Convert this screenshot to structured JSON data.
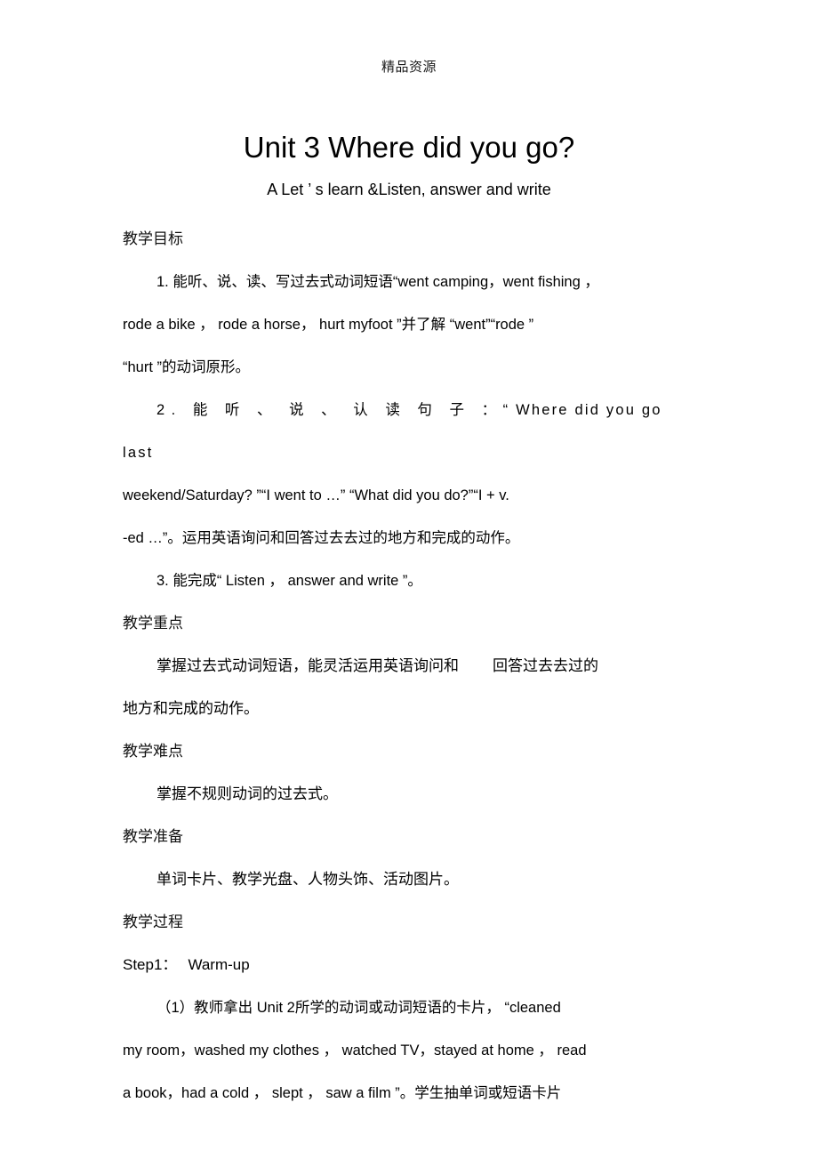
{
  "document": {
    "header": "精品资源",
    "title": "Unit 3 Where did you go?",
    "subtitle": "A Let ’ s learn &Listen, answer and write"
  },
  "sections": {
    "objectives": {
      "heading": "教学目标",
      "item1_line1": "1. 能听、说、读、写过去式动词短语“went camping，went fishing ",
      "item1_line1_tail": "，",
      "item1_line2": "rode a bike ， rode a horse， hurt myfoot ”并了解 “went”“rode ”",
      "item1_line3": "“hurt ”的动词原形。",
      "item2_line1_a": "2. 能 听 、 说 、 认 读 句 子 ：",
      "item2_line1_b": "“ Where did you go last",
      "item2_line2": "weekend/Saturday? ”“I went to …” “What did you do?”“I + v.",
      "item2_line3": "-ed …”。运用英语询问和回答过去去过的地方和完成的动作。",
      "item3": "3. 能完成“ Listen ， answer and write ”。"
    },
    "key_points": {
      "heading": "教学重点",
      "line1_a": "掌握过去式动词短语，能灵活运用英语询问和",
      "line1_b": "回答过去去过的",
      "line2": "地方和完成的动作。"
    },
    "difficulties": {
      "heading": "教学难点",
      "line1": "掌握不规则动词的过去式。"
    },
    "preparation": {
      "heading": "教学准备",
      "line1": "单词卡片、教学光盘、人物头饰、活动图片。"
    },
    "process": {
      "heading": "教学过程",
      "step1_label": "Step1：",
      "step1_title": "Warm-up",
      "p1_line1": "（1）教师拿出 Unit 2所学的动词或动词短语的卡片， “cleaned",
      "p1_line2": "my room，washed my clothes ， watched TV，stayed at home ， read",
      "p1_line3": "a book，had a cold ， slept ， saw a film ”。学生抽单词或短语卡片"
    }
  }
}
